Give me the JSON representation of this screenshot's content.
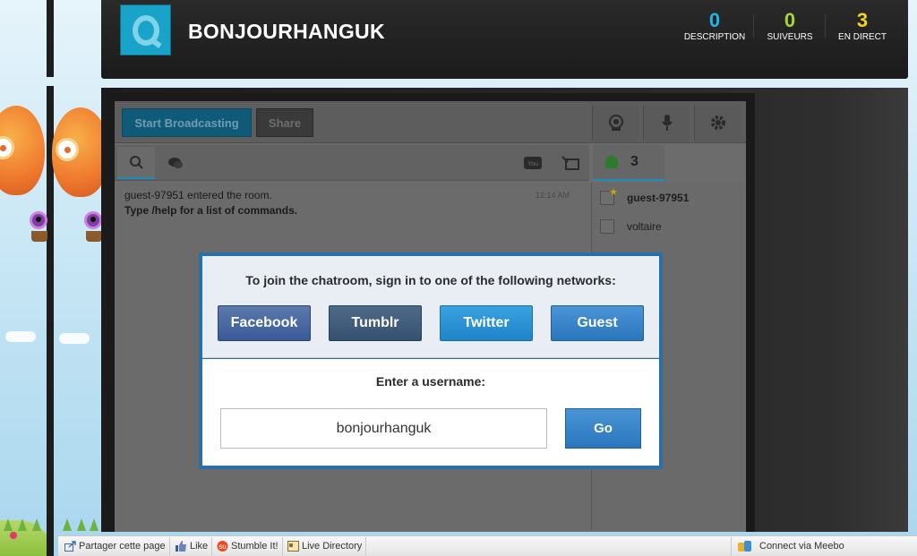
{
  "header": {
    "channel_name": "BONJOURHANGUK",
    "stats": [
      {
        "value": "0",
        "label": "DESCRIPTION",
        "color": "#1fb6e8"
      },
      {
        "value": "0",
        "label": "SUIVEURS",
        "color": "#a8d63a"
      },
      {
        "value": "3",
        "label": "EN DIRECT",
        "color": "#f5d21b"
      }
    ]
  },
  "toolbar": {
    "start_broadcasting": "Start Broadcasting",
    "share": "Share",
    "icons": [
      "webcam-icon",
      "microphone-icon",
      "settings-gear-icon"
    ]
  },
  "chat": {
    "tabs": [
      "chat-zoom-icon",
      "private-chat-icon",
      "youtube-icon",
      "image-upload-icon"
    ],
    "messages": [
      {
        "text": "guest-97951 entered the room.",
        "time": "12:14 AM"
      },
      {
        "text": "Type /help for a list of commands."
      }
    ],
    "user_count": "3",
    "users": [
      "guest-97951",
      "voltaire"
    ]
  },
  "modal": {
    "title": "To join the chatroom, sign in to one of the following networks:",
    "networks": [
      "Facebook",
      "Tumblr",
      "Twitter",
      "Guest"
    ],
    "username_label": "Enter a username:",
    "username_value": "bonjourhanguk",
    "go": "Go"
  },
  "bottom_bar": {
    "share_page": "Partager cette page",
    "like": "Like",
    "stumble": "Stumble It!",
    "live_directory": "Live Directory",
    "meebo": "Connect via Meebo"
  }
}
